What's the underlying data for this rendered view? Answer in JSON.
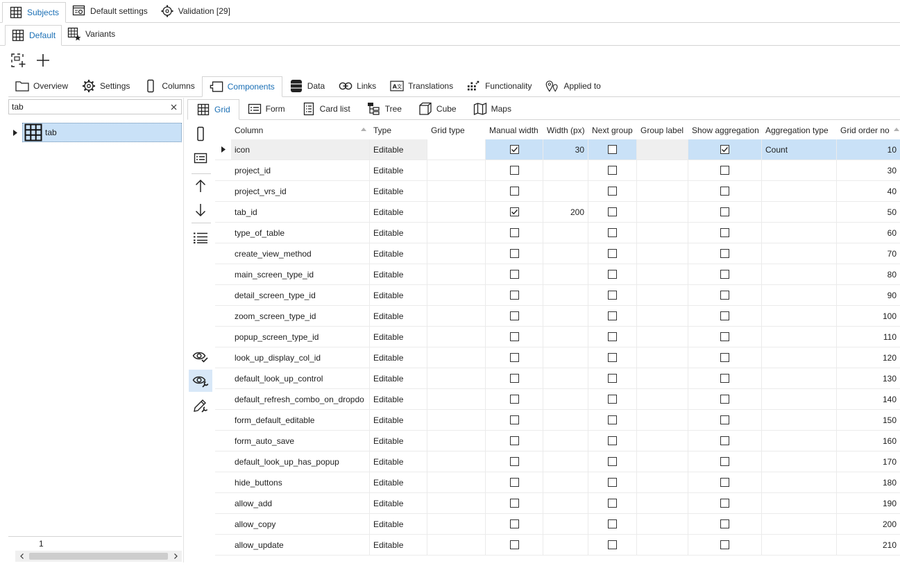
{
  "top_tabs": [
    {
      "label": "Subjects",
      "active": true
    },
    {
      "label": "Default settings",
      "active": false
    },
    {
      "label": "Validation [29]",
      "active": false
    }
  ],
  "sub_tabs": [
    {
      "label": "Default",
      "active": true
    },
    {
      "label": "Variants",
      "active": false
    }
  ],
  "main_tabs": [
    {
      "label": "Overview"
    },
    {
      "label": "Settings"
    },
    {
      "label": "Columns"
    },
    {
      "label": "Components",
      "active": true
    },
    {
      "label": "Data"
    },
    {
      "label": "Links"
    },
    {
      "label": "Translations"
    },
    {
      "label": "Functionality"
    },
    {
      "label": "Applied to"
    }
  ],
  "search": {
    "value": "tab"
  },
  "tree": {
    "node_label": "tab"
  },
  "pager": {
    "page": "1"
  },
  "component_tabs": [
    {
      "label": "Grid",
      "active": true
    },
    {
      "label": "Form"
    },
    {
      "label": "Card list"
    },
    {
      "label": "Tree"
    },
    {
      "label": "Cube"
    },
    {
      "label": "Maps"
    }
  ],
  "grid": {
    "headers": {
      "column": "Column",
      "type": "Type",
      "grid_type": "Grid type",
      "manual_width": "Manual width",
      "width_px": "Width (px)",
      "next_group": "Next group",
      "group_label": "Group label",
      "show_aggregation": "Show aggregation",
      "aggregation_type": "Aggregation type",
      "grid_order_no": "Grid order no"
    },
    "rows": [
      {
        "column": "icon",
        "type": "Editable",
        "manual_width": true,
        "width": "30",
        "next_group": false,
        "show_aggregation": true,
        "aggregation_type": "Count",
        "order": "10",
        "selected": true
      },
      {
        "column": "project_id",
        "type": "Editable",
        "manual_width": false,
        "width": "",
        "next_group": false,
        "show_aggregation": false,
        "aggregation_type": "",
        "order": "30"
      },
      {
        "column": "project_vrs_id",
        "type": "Editable",
        "manual_width": false,
        "width": "",
        "next_group": false,
        "show_aggregation": false,
        "aggregation_type": "",
        "order": "40"
      },
      {
        "column": "tab_id",
        "type": "Editable",
        "manual_width": true,
        "width": "200",
        "next_group": false,
        "show_aggregation": false,
        "aggregation_type": "",
        "order": "50"
      },
      {
        "column": "type_of_table",
        "type": "Editable",
        "manual_width": false,
        "width": "",
        "next_group": false,
        "show_aggregation": false,
        "aggregation_type": "",
        "order": "60"
      },
      {
        "column": "create_view_method",
        "type": "Editable",
        "manual_width": false,
        "width": "",
        "next_group": false,
        "show_aggregation": false,
        "aggregation_type": "",
        "order": "70"
      },
      {
        "column": "main_screen_type_id",
        "type": "Editable",
        "manual_width": false,
        "width": "",
        "next_group": false,
        "show_aggregation": false,
        "aggregation_type": "",
        "order": "80"
      },
      {
        "column": "detail_screen_type_id",
        "type": "Editable",
        "manual_width": false,
        "width": "",
        "next_group": false,
        "show_aggregation": false,
        "aggregation_type": "",
        "order": "90"
      },
      {
        "column": "zoom_screen_type_id",
        "type": "Editable",
        "manual_width": false,
        "width": "",
        "next_group": false,
        "show_aggregation": false,
        "aggregation_type": "",
        "order": "100"
      },
      {
        "column": "popup_screen_type_id",
        "type": "Editable",
        "manual_width": false,
        "width": "",
        "next_group": false,
        "show_aggregation": false,
        "aggregation_type": "",
        "order": "110"
      },
      {
        "column": "look_up_display_col_id",
        "type": "Editable",
        "manual_width": false,
        "width": "",
        "next_group": false,
        "show_aggregation": false,
        "aggregation_type": "",
        "order": "120"
      },
      {
        "column": "default_look_up_control",
        "type": "Editable",
        "manual_width": false,
        "width": "",
        "next_group": false,
        "show_aggregation": false,
        "aggregation_type": "",
        "order": "130"
      },
      {
        "column": "default_refresh_combo_on_dropdo",
        "type": "Editable",
        "manual_width": false,
        "width": "",
        "next_group": false,
        "show_aggregation": false,
        "aggregation_type": "",
        "order": "140"
      },
      {
        "column": "form_default_editable",
        "type": "Editable",
        "manual_width": false,
        "width": "",
        "next_group": false,
        "show_aggregation": false,
        "aggregation_type": "",
        "order": "150"
      },
      {
        "column": "form_auto_save",
        "type": "Editable",
        "manual_width": false,
        "width": "",
        "next_group": false,
        "show_aggregation": false,
        "aggregation_type": "",
        "order": "160"
      },
      {
        "column": "default_look_up_has_popup",
        "type": "Editable",
        "manual_width": false,
        "width": "",
        "next_group": false,
        "show_aggregation": false,
        "aggregation_type": "",
        "order": "170"
      },
      {
        "column": "hide_buttons",
        "type": "Editable",
        "manual_width": false,
        "width": "",
        "next_group": false,
        "show_aggregation": false,
        "aggregation_type": "",
        "order": "180"
      },
      {
        "column": "allow_add",
        "type": "Editable",
        "manual_width": false,
        "width": "",
        "next_group": false,
        "show_aggregation": false,
        "aggregation_type": "",
        "order": "190"
      },
      {
        "column": "allow_copy",
        "type": "Editable",
        "manual_width": false,
        "width": "",
        "next_group": false,
        "show_aggregation": false,
        "aggregation_type": "",
        "order": "200"
      },
      {
        "column": "allow_update",
        "type": "Editable",
        "manual_width": false,
        "width": "",
        "next_group": false,
        "show_aggregation": false,
        "aggregation_type": "",
        "order": "210"
      }
    ]
  },
  "colors": {
    "accent": "#1a6fb5",
    "selection": "#c9e1f7",
    "border": "#d4d4d4"
  }
}
